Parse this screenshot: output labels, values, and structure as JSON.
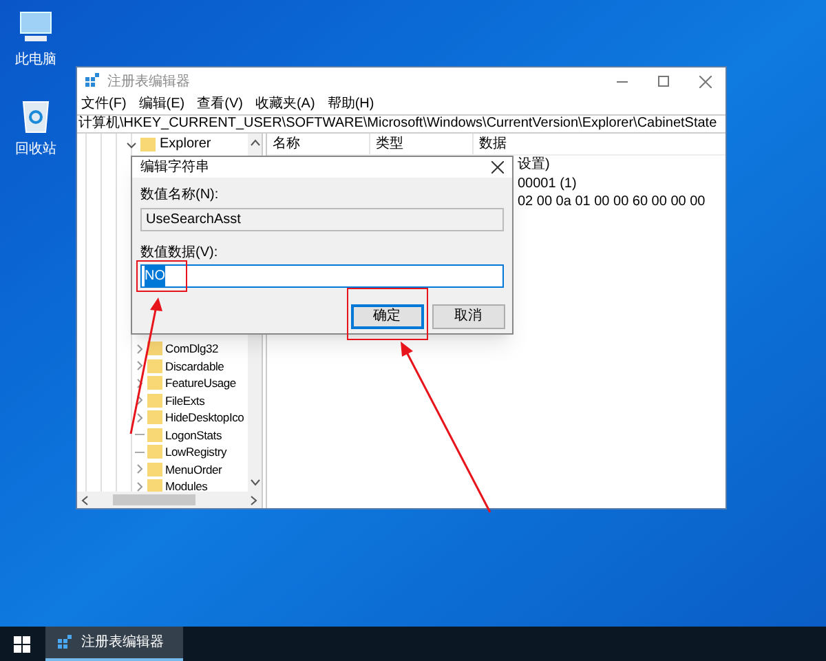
{
  "desktop_icons": [
    {
      "label": "此电脑",
      "kind": "computer"
    },
    {
      "label": "回收站",
      "kind": "recycle"
    }
  ],
  "window": {
    "title": "注册表编辑器",
    "menu": [
      "文件(F)",
      "编辑(E)",
      "查看(V)",
      "收藏夹(A)",
      "帮助(H)"
    ],
    "address": "计算机\\HKEY_CURRENT_USER\\SOFTWARE\\Microsoft\\Windows\\CurrentVersion\\Explorer\\CabinetState",
    "tree": [
      {
        "label": "Explorer",
        "expanded": true,
        "children": [
          {
            "label": "ComDlg32",
            "expandable": true
          },
          {
            "label": "Discardable",
            "expandable": true
          },
          {
            "label": "FeatureUsage",
            "expandable": true
          },
          {
            "label": "FileExts",
            "expandable": true
          },
          {
            "label": "HideDesktopIco",
            "expandable": true
          },
          {
            "label": "LogonStats",
            "expandable": false
          },
          {
            "label": "LowRegistry",
            "expandable": false
          },
          {
            "label": "MenuOrder",
            "expandable": true
          },
          {
            "label": "Modules",
            "expandable": true
          }
        ]
      }
    ],
    "columns": [
      "名称",
      "类型",
      "数据"
    ],
    "rows": [
      {
        "column_3": "设置)"
      },
      {
        "column_3": "00001 (1)"
      },
      {
        "column_3": "02 00 0a 01 00 00 60 00 00 00"
      }
    ]
  },
  "dialog": {
    "title": "编辑字符串",
    "name_label": "数值名称(N):",
    "name_value": "UseSearchAsst",
    "data_label": "数值数据(V):",
    "data_value": "NO",
    "data_value_selected": true,
    "data_highlighted": true,
    "buttons": [
      {
        "label": "确定",
        "kind": "ok",
        "highlighted": true
      },
      {
        "label": "取消",
        "kind": "cancel",
        "highlighted": false
      }
    ]
  },
  "taskbar": {
    "items": [
      {
        "label": "注册表编辑器",
        "active": true
      }
    ]
  }
}
